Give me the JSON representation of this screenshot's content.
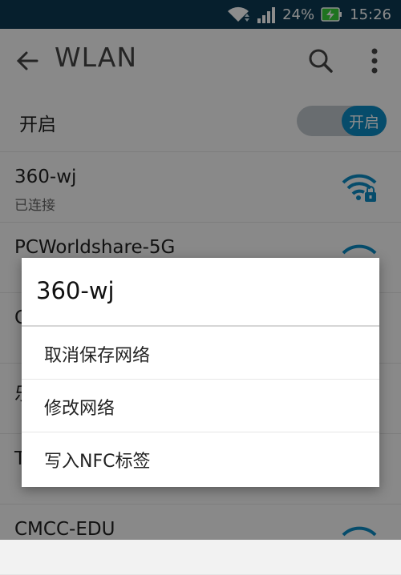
{
  "status_bar": {
    "battery": "24%",
    "time": "15:26",
    "icons": [
      "wifi-icon",
      "signal-icon",
      "battery-charging-icon"
    ]
  },
  "app_bar": {
    "title": "WLAN",
    "icons": [
      "back-arrow-icon",
      "search-icon",
      "more-vert-icon"
    ]
  },
  "toggle_row": {
    "label": "开启",
    "switch_text": "开启",
    "state": "on"
  },
  "networks": [
    {
      "name": "360-wj",
      "status": "已连接"
    },
    {
      "name": "PCWorldshare-5G",
      "status": ""
    },
    {
      "name": "C",
      "status": ""
    },
    {
      "name": "乐",
      "status": ""
    },
    {
      "name": "T",
      "status": ""
    },
    {
      "name": "CMCC-EDU",
      "status": ""
    }
  ],
  "dialog": {
    "title": "360-wj",
    "options": [
      "取消保存网络",
      "修改网络",
      "写入NFC标签"
    ]
  },
  "colors": {
    "status_bar_bg": "#0c3a52",
    "accent": "#0b8bc4",
    "toggle_track": "#bfc7cc"
  }
}
